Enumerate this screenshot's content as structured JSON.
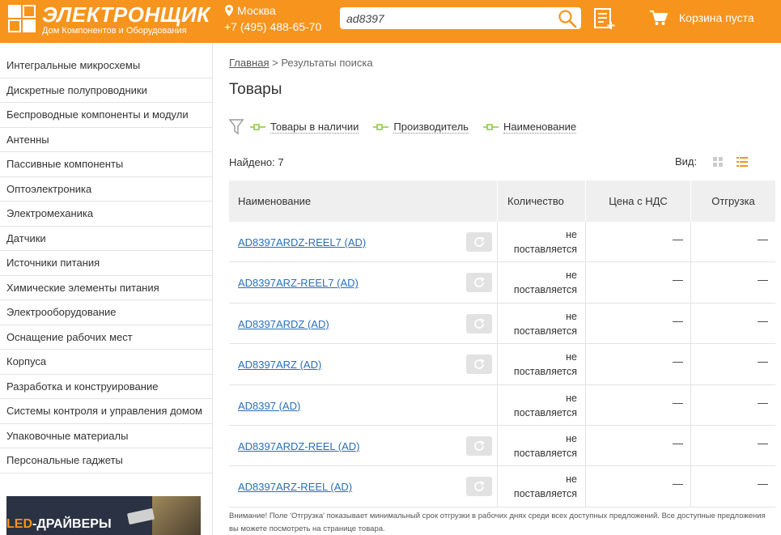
{
  "header": {
    "logo_title": "ЭЛЕКТРОНЩИК",
    "logo_subtitle": "Дом Компонентов и Оборудования",
    "city": "Москва",
    "phone": "+7 (495) 488-65-70",
    "search_value": "ad8397",
    "cart_label": "Корзина пуста",
    "accent_color": "#f7941d"
  },
  "sidebar": {
    "categories": [
      "Интегральные микросхемы",
      "Дискретные полупроводники",
      "Беспроводные компоненты и модули",
      "Антенны",
      "Пассивные компоненты",
      "Оптоэлектроника",
      "Электромеханика",
      "Датчики",
      "Источники питания",
      "Химические элементы питания",
      "Электрооборудование",
      "Оснащение рабочих мест",
      "Корпуса",
      "Разработка и конструирование",
      "Системы контроля и управления домом",
      "Упаковочные материалы",
      "Персональные гаджеты"
    ],
    "banner": {
      "highlight": "LED",
      "rest": "-ДРАЙВЕРЫ"
    }
  },
  "main": {
    "breadcrumb_home": "Главная",
    "breadcrumb_sep": " > ",
    "breadcrumb_current": "Результаты поиска",
    "title": "Товары",
    "filters": [
      "Товары в наличии",
      "Производитель",
      "Наименование"
    ],
    "found": "Найдено: 7",
    "view_label": "Вид:",
    "table": {
      "headers": [
        "Наименование",
        "Количество",
        "Цена с НДС",
        "Отгрузка"
      ],
      "rows": [
        {
          "name": "AD8397ARDZ-REEL7 (AD)",
          "qty_line1": "не",
          "qty_line2": "поставляется",
          "price": "—",
          "ship": "—",
          "refresh": true
        },
        {
          "name": "AD8397ARZ-REEL7 (AD)",
          "qty_line1": "не",
          "qty_line2": "поставляется",
          "price": "—",
          "ship": "—",
          "refresh": true
        },
        {
          "name": "AD8397ARDZ (AD)",
          "qty_line1": "не",
          "qty_line2": "поставляется",
          "price": "—",
          "ship": "—",
          "refresh": true
        },
        {
          "name": "AD8397ARZ (AD)",
          "qty_line1": "не",
          "qty_line2": "поставляется",
          "price": "—",
          "ship": "—",
          "refresh": true
        },
        {
          "name": "AD8397 (AD)",
          "qty_line1": "не",
          "qty_line2": "поставляется",
          "price": "—",
          "ship": "—",
          "refresh": false
        },
        {
          "name": "AD8397ARDZ-REEL (AD)",
          "qty_line1": "не",
          "qty_line2": "поставляется",
          "price": "—",
          "ship": "—",
          "refresh": true
        },
        {
          "name": "AD8397ARZ-REEL (AD)",
          "qty_line1": "не",
          "qty_line2": "поставляется",
          "price": "—",
          "ship": "—",
          "refresh": true
        }
      ]
    },
    "note": "Внимание! Поле 'Отгрузка' показывает минимальный срок отгрузки в рабочих днях среди всех доступных предложений. Все доступные предложения вы можете посмотреть на странице товара."
  }
}
